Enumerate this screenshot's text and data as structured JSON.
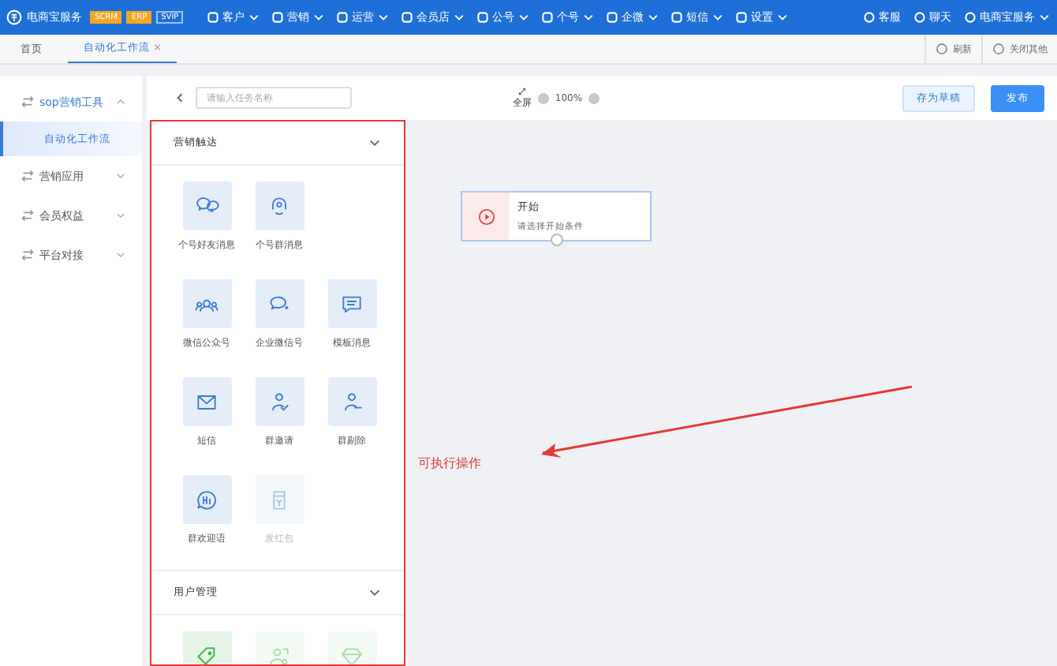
{
  "topbar": {
    "brand": "电商宝服务",
    "badges": [
      "SCRM",
      "ERP",
      "SVIP"
    ],
    "menu": [
      {
        "label": "客户"
      },
      {
        "label": "营销"
      },
      {
        "label": "运营"
      },
      {
        "label": "会员店"
      },
      {
        "label": "公号"
      },
      {
        "label": "个号"
      },
      {
        "label": "企微"
      },
      {
        "label": "短信"
      },
      {
        "label": "设置"
      }
    ],
    "right": [
      {
        "label": "客服"
      },
      {
        "label": "聊天"
      },
      {
        "label": "电商宝服务"
      }
    ]
  },
  "tabs": [
    {
      "label": "首页",
      "selected": false
    },
    {
      "label": "自动化工作流",
      "selected": true,
      "close": "×"
    }
  ],
  "tab_actions": [
    "刷新",
    "关闭其他"
  ],
  "sidebar": {
    "items": [
      {
        "label": "sop营销工具",
        "expanded": true,
        "children": [
          {
            "label": "自动化工作流",
            "selected": true
          }
        ]
      },
      {
        "label": "营销应用",
        "expanded": false
      },
      {
        "label": "会员权益",
        "expanded": false
      },
      {
        "label": "平台对接",
        "expanded": false
      }
    ]
  },
  "toolbar": {
    "search": {
      "placeholder": "请输入任务名称"
    },
    "fullscreen": "全屏",
    "zoom": "100%",
    "buttons": [
      "存为草稿",
      "发布"
    ]
  },
  "palette": {
    "sections": [
      {
        "title": "营销触达",
        "expanded": true,
        "color": "#3a7bd5",
        "rows": [
          [
            {
              "label": "个号好友消息",
              "disabled": false
            },
            {
              "label": "个号群消息",
              "disabled": false
            }
          ],
          [
            {
              "label": "微信公众号",
              "disabled": false
            },
            {
              "label": "企业微信号",
              "disabled": false
            },
            {
              "label": "模板消息",
              "disabled": false
            }
          ],
          [
            {
              "label": "短信",
              "disabled": false
            },
            {
              "label": "群邀请",
              "disabled": false
            },
            {
              "label": "群剔除",
              "disabled": false
            }
          ],
          [
            {
              "label": "群欢迎语",
              "disabled": false
            },
            {
              "label": "发红包",
              "disabled": true
            }
          ]
        ]
      },
      {
        "title": "用户管理",
        "expanded": true,
        "color": "#3cb043",
        "rows": [
          [
            {
              "disabled": false
            },
            {
              "disabled": true
            },
            {
              "disabled": true
            }
          ]
        ]
      }
    ]
  },
  "canvas": {
    "node": {
      "title": "开始",
      "subtitle": "请选择开始条件"
    },
    "annotation": "可执行操作"
  }
}
